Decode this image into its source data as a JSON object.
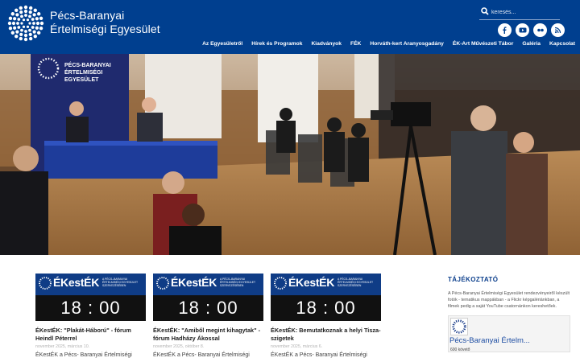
{
  "site": {
    "title_line1": "Pécs-Baranyai",
    "title_line2": "Értelmiségi Egyesület"
  },
  "search": {
    "placeholder": "keresés..."
  },
  "social": [
    {
      "name": "facebook-icon",
      "glyph": "f"
    },
    {
      "name": "youtube-icon",
      "glyph": "▶"
    },
    {
      "name": "flickr-icon",
      "glyph": "●●"
    },
    {
      "name": "rss-icon",
      "glyph": "rss"
    }
  ],
  "nav": [
    "Az Egyesületről",
    "Hírek és Programok",
    "Kiadványok",
    "FÉK",
    "Horváth-kert Aranyosgadány",
    "ÉK-Art Művészeti Tábor",
    "Galéria",
    "Kapcsolat"
  ],
  "hero": {
    "banner_line1": "PÉCS-BARANYAI",
    "banner_line2": "ÉRTELMISÉGI",
    "banner_line3": "EGYESÜLET"
  },
  "posts": [
    {
      "thumb_title": "ÉKestÉK",
      "thumb_sub": "A PÉCS–BARANYAI ÉRTELMISÉGI EGYESÜLET SZERVEZÉSÉBEN",
      "time": "18 : 00",
      "title": "ÉKestÉK: \"Plakát-Háború\" - fórum Heindl Péterrel",
      "date": "november 2025, március 10.",
      "excerpt": "ÉKestÉK a Pécs- Baranyai Értelmiségi"
    },
    {
      "thumb_title": "ÉKestÉK",
      "thumb_sub": "A PÉCS–BARANYAI ÉRTELMISÉGI EGYESÜLET SZERVEZÉSÉBEN",
      "time": "18 : 00",
      "title": "ÉKestÉK: \"Amiből megint kihagytak\" - fórum Hadházy Ákossal",
      "date": "november 2025, október 8.",
      "excerpt": "ÉKestÉK a Pécs- Baranyai Értelmiségi"
    },
    {
      "thumb_title": "ÉKestÉK",
      "thumb_sub": "A PÉCS–BARANYAI ÉRTELMISÉGI EGYESÜLET SZERVEZÉSÉBEN",
      "time": "18 : 00",
      "title": "ÉKestÉK: Bemutatkoznak a helyi Tisza-szigetek",
      "date": "november 2025, március 6.",
      "excerpt": "ÉKestÉK a Pécs- Baranyai Értelmiségi"
    }
  ],
  "sidebar": {
    "title": "TÁJÉKOZTATÓ",
    "text": "A Pécs-Baranyai Értelmiségi Egyesület rendezvényeiről készült fotók - tematikus mappákban - a Flickr képgalériánkban, a filmek pedig a saját YouTube csatornánkon kereshetőek.",
    "fb_name": "Pécs-Baranyai Értelm...",
    "fb_count": "600 követő"
  },
  "colors": {
    "header": "#003f8f",
    "accent": "#0c3f8c"
  }
}
